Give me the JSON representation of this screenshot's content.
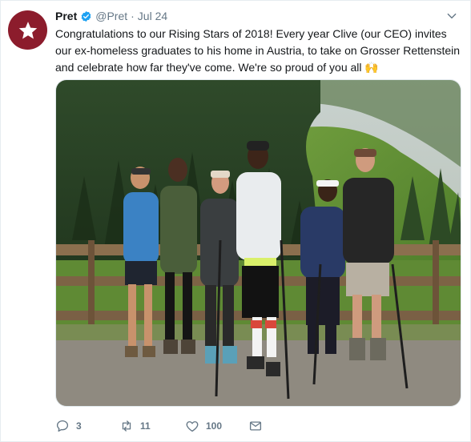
{
  "tweet": {
    "author_name": "Pret",
    "handle": "@Pret",
    "separator": "·",
    "date": "Jul 24",
    "text": "Congratulations to our Rising Stars of 2018! Every year Clive (our CEO) invites our ex-homeless graduates to his home in Austria, to take on Grosser Rettenstein and celebrate how far they've come. We're so proud of you all 🙌"
  },
  "actions": {
    "reply_count": "3",
    "retweet_count": "11",
    "like_count": "100"
  },
  "colors": {
    "brand": "#8c1c2c",
    "verified": "#1da1f2",
    "muted": "#657786",
    "text": "#14171a"
  },
  "icons": [
    "star-logo-icon",
    "verified-badge-icon",
    "chevron-down-icon",
    "reply-icon",
    "retweet-icon",
    "like-icon",
    "direct-message-icon"
  ]
}
